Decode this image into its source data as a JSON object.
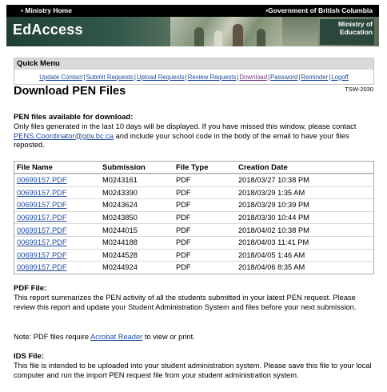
{
  "banner": {
    "ministry_home": "▪ Ministry Home",
    "government": "▪Government of British Columbia",
    "app_title": "EdAccess",
    "ministry_badge": "Ministry of\nEducation"
  },
  "quick_menu": {
    "title": "Quick Menu",
    "links": [
      "Update Contact",
      "Submit Requests",
      "Upload Requests",
      "Review Requests",
      "Download",
      "Password",
      "Reminder",
      "Logoff"
    ],
    "separator": "|"
  },
  "page": {
    "title": "Download PEN Files",
    "code": "TSW-2030"
  },
  "available": {
    "heading": "PEN files available for download:",
    "text_before": "Only files generated in the last 10 days will be displayed. If you have missed this window, please contact ",
    "email": "PENS.Coordinator@gov.bc.ca",
    "text_after": " and include your school code in the body of the email to have your files reposted."
  },
  "table": {
    "headers": [
      "File Name",
      "Submission",
      "File Type",
      "Creation Date"
    ],
    "rows": [
      {
        "file": "00699157.PDF",
        "submission": "M0243161",
        "type": "PDF",
        "date": "2018/03/27 10:38 PM"
      },
      {
        "file": "00699157.PDF",
        "submission": "M0243390",
        "type": "PDF",
        "date": "2018/03/29 1:35 AM"
      },
      {
        "file": "00699157.PDF",
        "submission": "M0243624",
        "type": "PDF",
        "date": "2018/03/29 10:39 PM"
      },
      {
        "file": "00699157.PDF",
        "submission": "M0243850",
        "type": "PDF",
        "date": "2018/03/30 10:44 PM"
      },
      {
        "file": "00699157.PDF",
        "submission": "M0244015",
        "type": "PDF",
        "date": "2018/04/02 10:38 PM"
      },
      {
        "file": "00699157.PDF",
        "submission": "M0244188",
        "type": "PDF",
        "date": "2018/04/03 11:41 PM"
      },
      {
        "file": "00699157.PDF",
        "submission": "M0244528",
        "type": "PDF",
        "date": "2018/04/05 1:46 AM"
      },
      {
        "file": "00699157.PDF",
        "submission": "M0244924",
        "type": "PDF",
        "date": "2018/04/06 8:35 AM"
      }
    ]
  },
  "pdf_section": {
    "heading": "PDF File:",
    "text": "This report summarizes the PEN activity of all the students submitted in your latest PEN request. Please review this report and update your Student Administration System and files before your next submission.",
    "note_before": "Note: PDF files require ",
    "note_link": "Acrobat Reader",
    "note_after": " to view or print."
  },
  "ids_section": {
    "heading": "IDS File:",
    "text": "This file is intended to be uploaded into your student administration system. Please save this file to your local computer and run the import PEN request file from your student administration system."
  },
  "colors": {
    "link": "#1e4a9c",
    "visited": "#7a3a8a",
    "banner_dark": "#1f3f34"
  }
}
